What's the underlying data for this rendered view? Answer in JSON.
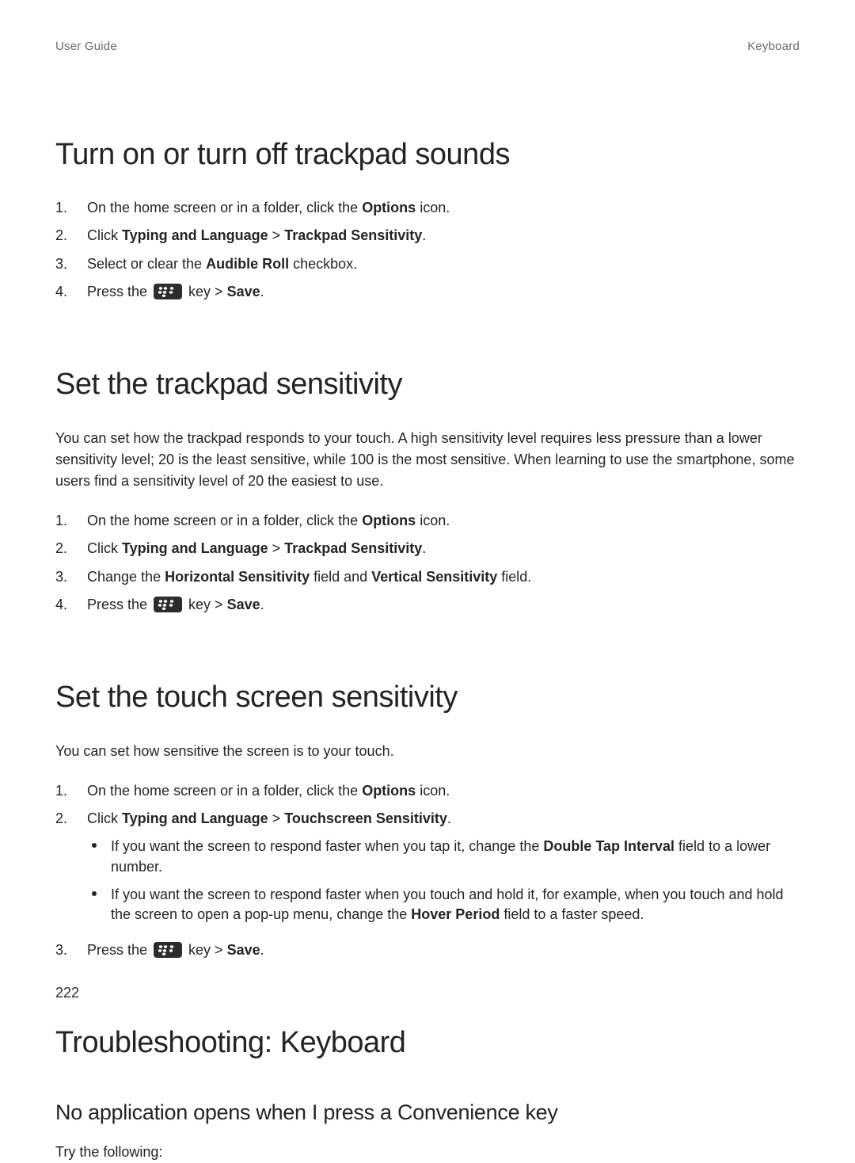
{
  "header": {
    "left": "User Guide",
    "right": "Keyboard"
  },
  "page_number": "222",
  "sections": [
    {
      "heading": "Turn on or turn off trackpad sounds",
      "intro": "",
      "steps": [
        [
          {
            "t": "On the home screen or in a folder, click the "
          },
          {
            "t": "Options",
            "b": true
          },
          {
            "t": " icon."
          }
        ],
        [
          {
            "t": "Click "
          },
          {
            "t": "Typing and Language",
            "b": true
          },
          {
            "t": " > "
          },
          {
            "t": "Trackpad Sensitivity",
            "b": true
          },
          {
            "t": "."
          }
        ],
        [
          {
            "t": "Select or clear the "
          },
          {
            "t": "Audible Roll",
            "b": true
          },
          {
            "t": " checkbox."
          }
        ],
        [
          {
            "t": "Press the "
          },
          {
            "icon": "bb"
          },
          {
            "t": " key > "
          },
          {
            "t": "Save",
            "b": true
          },
          {
            "t": "."
          }
        ]
      ]
    },
    {
      "heading": "Set the trackpad sensitivity",
      "intro": "You can set how the trackpad responds to your touch. A high sensitivity level requires less pressure than a lower sensitivity level; 20 is the least sensitive, while 100 is the most sensitive. When learning to use the smartphone, some users find a sensitivity level of 20 the easiest to use.",
      "steps": [
        [
          {
            "t": "On the home screen or in a folder, click the "
          },
          {
            "t": "Options",
            "b": true
          },
          {
            "t": " icon."
          }
        ],
        [
          {
            "t": "Click "
          },
          {
            "t": "Typing and Language",
            "b": true
          },
          {
            "t": " > "
          },
          {
            "t": "Trackpad Sensitivity",
            "b": true
          },
          {
            "t": "."
          }
        ],
        [
          {
            "t": "Change the "
          },
          {
            "t": "Horizontal Sensitivity",
            "b": true
          },
          {
            "t": " field and "
          },
          {
            "t": "Vertical Sensitivity",
            "b": true
          },
          {
            "t": " field."
          }
        ],
        [
          {
            "t": "Press the "
          },
          {
            "icon": "bb"
          },
          {
            "t": " key > "
          },
          {
            "t": "Save",
            "b": true
          },
          {
            "t": "."
          }
        ]
      ]
    },
    {
      "heading": "Set the touch screen sensitivity",
      "intro": "You can set how sensitive the screen is to your touch.",
      "steps": [
        [
          {
            "t": "On the home screen or in a folder, click the "
          },
          {
            "t": "Options",
            "b": true
          },
          {
            "t": " icon."
          }
        ],
        [
          {
            "t": "Click "
          },
          {
            "t": "Typing and Language",
            "b": true
          },
          {
            "t": " > "
          },
          {
            "t": "Touchscreen Sensitivity",
            "b": true
          },
          {
            "t": "."
          }
        ],
        [
          {
            "t": "Press the "
          },
          {
            "icon": "bb"
          },
          {
            "t": " key > "
          },
          {
            "t": "Save",
            "b": true
          },
          {
            "t": "."
          }
        ]
      ],
      "sub_bullets_after_step": 1,
      "bullets": [
        [
          {
            "t": "If you want the screen to respond faster when you tap it, change the "
          },
          {
            "t": "Double Tap Interval",
            "b": true
          },
          {
            "t": " field to a lower number."
          }
        ],
        [
          {
            "t": "If you want the screen to respond faster when you touch and hold it, for example, when you touch and hold the screen to open a pop-up menu, change the "
          },
          {
            "t": "Hover Period",
            "b": true
          },
          {
            "t": " field to a faster speed."
          }
        ]
      ]
    },
    {
      "heading": "Troubleshooting: Keyboard",
      "subheading": "No application opens when I press a Convenience key",
      "subtext": "Try the following:"
    }
  ]
}
